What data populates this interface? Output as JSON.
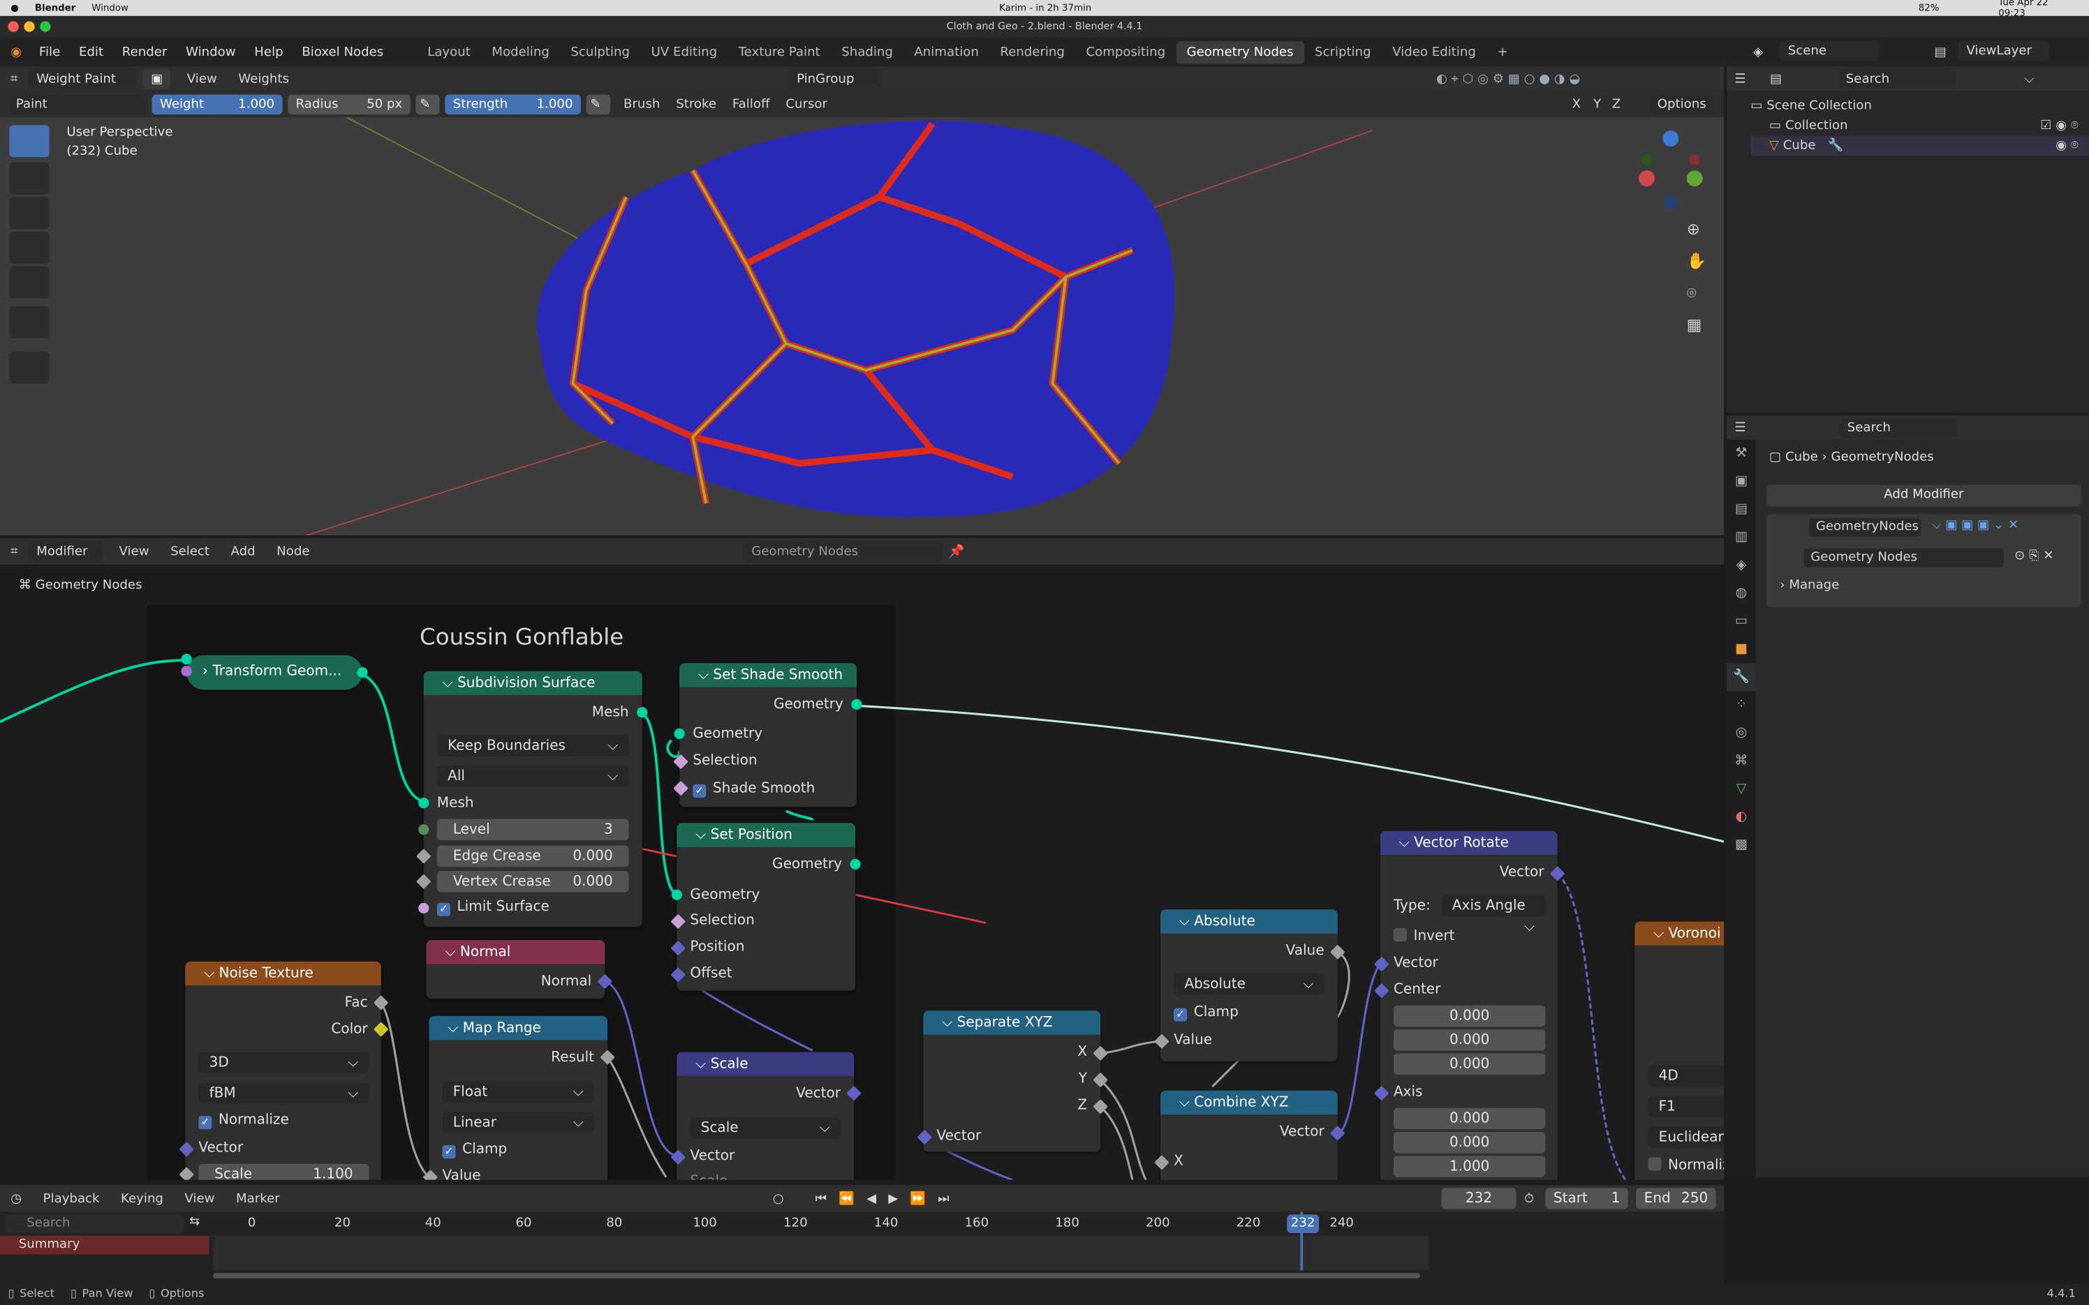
{
  "macbar": {
    "apple": "",
    "app": "Blender",
    "menu1": "Window",
    "center": "Karim - in 2h 37min",
    "datetime": "Tue Apr 22  09:23",
    "battery": "82%"
  },
  "window_title": "Cloth and Geo - 2.blend - Blender 4.4.1",
  "menubar": [
    "File",
    "Edit",
    "Render",
    "Window",
    "Help",
    "Bioxel Nodes"
  ],
  "workspaces": [
    "Layout",
    "Modeling",
    "Sculpting",
    "UV Editing",
    "Texture Paint",
    "Shading",
    "Animation",
    "Rendering",
    "Compositing",
    "Geometry Nodes",
    "Scripting",
    "Video Editing"
  ],
  "active_workspace": "Geometry Nodes",
  "scene": {
    "scene_name": "Scene",
    "viewlayer": "ViewLayer"
  },
  "viewport_header": {
    "mode": "Weight Paint",
    "view": "View",
    "weights": "Weights",
    "pin": "PinGroup",
    "options": "Options"
  },
  "tool_header": {
    "brush": "Paint",
    "weight_label": "Weight",
    "weight_value": "1.000",
    "radius_label": "Radius",
    "radius_value": "50 px",
    "strength_label": "Strength",
    "strength_value": "1.000",
    "menus": [
      "Brush",
      "Stroke",
      "Falloff",
      "Cursor"
    ],
    "axis": [
      "X",
      "Y",
      "Z"
    ]
  },
  "viewport": {
    "perspective": "User Perspective",
    "object": "(232) Cube"
  },
  "outliner": {
    "search": "Search",
    "items": [
      "Scene Collection",
      "Collection",
      "Cube"
    ]
  },
  "properties": {
    "search": "Search",
    "breadcrumb_obj": "Cube",
    "breadcrumb_mod": "GeometryNodes",
    "add_modifier": "Add Modifier",
    "modifier_name": "GeometryNodes",
    "node_group": "Geometry Nodes",
    "manage": "Manage"
  },
  "node_editor_header": {
    "editor": "Modifier",
    "menus": [
      "View",
      "Select",
      "Add",
      "Node"
    ],
    "group": "Geometry Nodes",
    "breadcrumb": "Geometry Nodes"
  },
  "frame_label": "Coussin Gonflable",
  "nodes": {
    "transform": "Transform Geom...",
    "subdiv": {
      "title": "Subdivision Surface",
      "mesh_out": "Mesh",
      "boundaries": "Keep Boundaries",
      "all": "All",
      "mesh_in": "Mesh",
      "level_label": "Level",
      "level": "3",
      "edge_label": "Edge Crease",
      "edge": "0.000",
      "vertex_label": "Vertex Crease",
      "vertex": "0.000",
      "limit": "Limit Surface"
    },
    "shade": {
      "title": "Set Shade Smooth",
      "geo_out": "Geometry",
      "geo_in": "Geometry",
      "selection": "Selection",
      "shade": "Shade Smooth"
    },
    "setpos": {
      "title": "Set Position",
      "geo_out": "Geometry",
      "geo_in": "Geometry",
      "selection": "Selection",
      "position": "Position",
      "offset": "Offset"
    },
    "noise": {
      "title": "Noise Texture",
      "fac": "Fac",
      "color": "Color",
      "dim": "3D",
      "type": "fBM",
      "normalize": "Normalize",
      "vector": "Vector",
      "scale_label": "Scale",
      "scale": "1.100"
    },
    "normal": {
      "title": "Normal",
      "out": "Normal"
    },
    "maprange": {
      "title": "Map Range",
      "result": "Result",
      "dtype": "Float",
      "interp": "Linear",
      "clamp": "Clamp",
      "value": "Value"
    },
    "scale": {
      "title": "Scale",
      "vector_out": "Vector",
      "mode": "Scale",
      "vector_in": "Vector",
      "scale": "Scale"
    },
    "sepxyz": {
      "title": "Separate XYZ",
      "x": "X",
      "y": "Y",
      "z": "Z",
      "vector": "Vector"
    },
    "absolute": {
      "title": "Absolute",
      "value_out": "Value",
      "mode": "Absolute",
      "clamp": "Clamp",
      "value_in": "Value"
    },
    "combxyz": {
      "title": "Combine XYZ",
      "vector": "Vector",
      "x": "X"
    },
    "vrot": {
      "title": "Vector Rotate",
      "vector_out": "Vector",
      "type_label": "Type:",
      "type": "Axis Angle",
      "invert": "Invert",
      "vector_in": "Vector",
      "center": "Center",
      "c1": "0.000",
      "c2": "0.000",
      "c3": "0.000",
      "axis": "Axis",
      "a1": "0.000",
      "a2": "0.000",
      "a3": "1.000"
    },
    "voronoi": {
      "title": "Voronoi T",
      "dim": "4D",
      "feature": "F1",
      "metric": "Euclidean",
      "normalize": "Normaliz"
    }
  },
  "timeline": {
    "menus": [
      "Playback",
      "Keying",
      "View",
      "Marker"
    ],
    "frame": "232",
    "start_label": "Start",
    "start": "1",
    "end_label": "End",
    "end": "250",
    "search": "Search",
    "summary": "Summary",
    "ticks": [
      "0",
      "20",
      "40",
      "60",
      "80",
      "100",
      "120",
      "140",
      "160",
      "180",
      "200",
      "220",
      "232",
      "240"
    ]
  },
  "statusbar": {
    "select": "Select",
    "pan": "Pan View",
    "options": "Options",
    "version": "4.4.1"
  },
  "colors": {
    "accent": "#4772b3",
    "geometry_socket": "#00d6a3",
    "vector_socket": "#6363c7",
    "float_socket": "#a1a1a1"
  }
}
